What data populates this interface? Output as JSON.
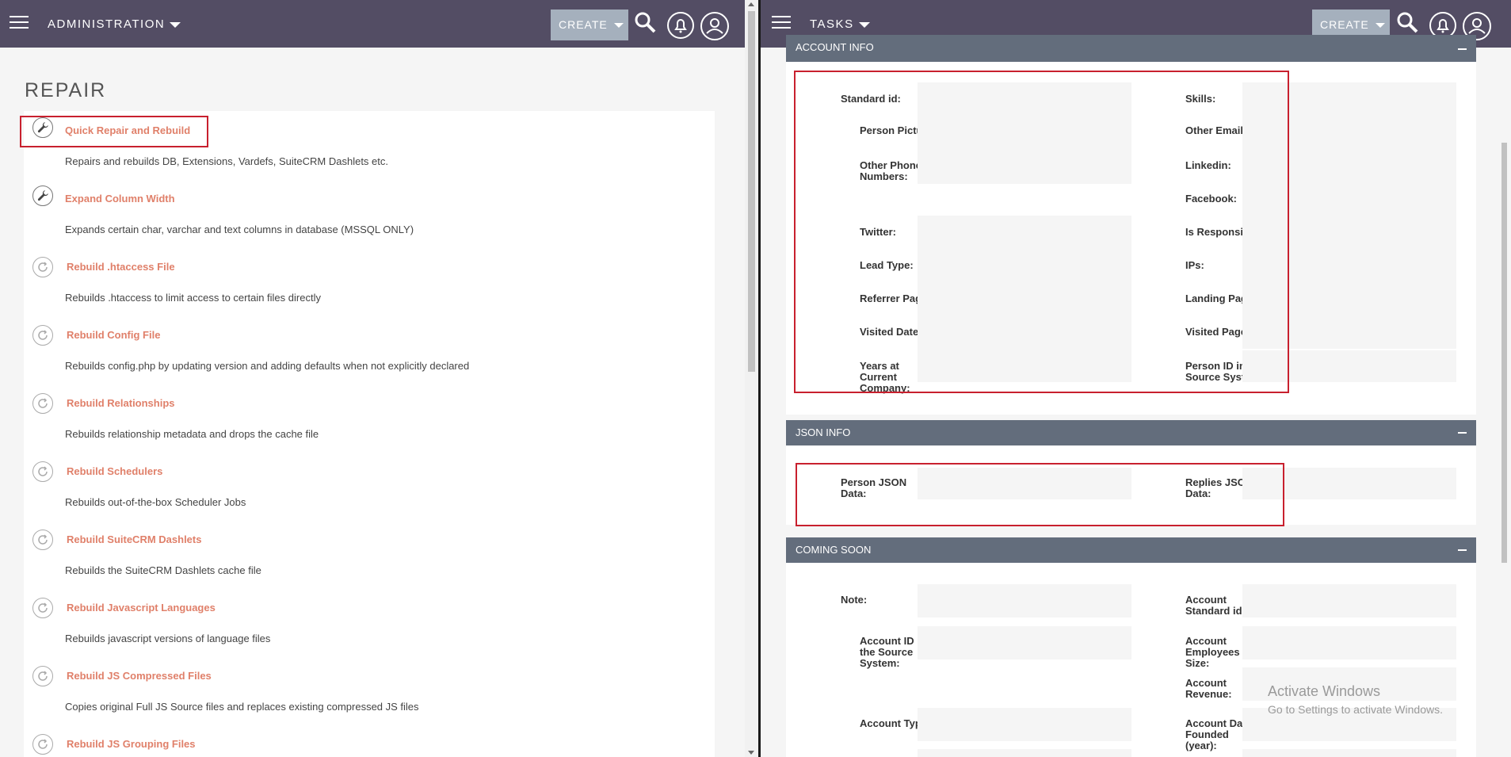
{
  "left": {
    "header": {
      "title": "ADMINISTRATION",
      "create_label": "CREATE"
    },
    "page_title": "REPAIR",
    "items": [
      {
        "label": "Quick Repair and Rebuild",
        "desc": "Repairs and rebuilds DB, Extensions, Vardefs, SuiteCRM Dashlets etc.",
        "icon": "wrench-icon"
      },
      {
        "label": "Expand Column Width",
        "desc": "Expands certain char, varchar and text columns in database (MSSQL ONLY)",
        "icon": "wrench-icon"
      },
      {
        "label": "Rebuild .htaccess File",
        "desc": "Rebuilds .htaccess to limit access to certain files directly",
        "icon": "refresh-icon"
      },
      {
        "label": "Rebuild Config File",
        "desc": "Rebuilds config.php by updating version and adding defaults when not explicitly declared",
        "icon": "refresh-icon"
      },
      {
        "label": "Rebuild Relationships",
        "desc": "Rebuilds relationship metadata and drops the cache file",
        "icon": "refresh-icon"
      },
      {
        "label": "Rebuild Schedulers",
        "desc": "Rebuilds out-of-the-box Scheduler Jobs",
        "icon": "refresh-icon"
      },
      {
        "label": "Rebuild SuiteCRM Dashlets",
        "desc": "Rebuilds the SuiteCRM Dashlets cache file",
        "icon": "refresh-icon"
      },
      {
        "label": "Rebuild Javascript Languages",
        "desc": "Rebuilds javascript versions of language files",
        "icon": "refresh-icon"
      },
      {
        "label": "Rebuild JS Compressed Files",
        "desc": "Copies original Full JS Source files and replaces existing compressed JS files",
        "icon": "refresh-icon"
      },
      {
        "label": "Rebuild JS Grouping Files",
        "desc": "",
        "icon": "refresh-icon"
      }
    ]
  },
  "right": {
    "header": {
      "title": "TASKS",
      "create_label": "CREATE"
    },
    "account_info": {
      "title": "ACCOUNT INFO",
      "left_fields": [
        "Standard id:",
        "Person Picture:",
        "Other Phone Numbers:",
        "Twitter:",
        "Lead Type:",
        "Referrer Pages:",
        "Visited Dates:",
        "Years at Current Company:"
      ],
      "right_fields": [
        "Skills:",
        "Other Emails:",
        "Linkedin:",
        "Facebook:",
        "Is Responsive:",
        "IPs:",
        "Landing Pages:",
        "Visited Pages:",
        "Person ID in the Source System:"
      ]
    },
    "json_info": {
      "title": "JSON INFO",
      "left_fields": [
        "Person JSON Data:"
      ],
      "right_fields": [
        "Replies JSON Data:"
      ]
    },
    "coming_soon": {
      "title": "COMING SOON",
      "left_fields": [
        "Note:",
        "Account ID in the Source System:",
        "Account Type:"
      ],
      "right_fields": [
        "Account Standard id:",
        "Account Employees Size:",
        "Account Revenue:",
        "Account Date Founded (year):"
      ]
    },
    "watermark": {
      "line1": "Activate Windows",
      "line2": "Go to Settings to activate Windows."
    }
  },
  "colors": {
    "topbar": "#534d64",
    "link": "#e0806a",
    "panel_header": "#636d7c",
    "highlight": "#c8202e"
  }
}
